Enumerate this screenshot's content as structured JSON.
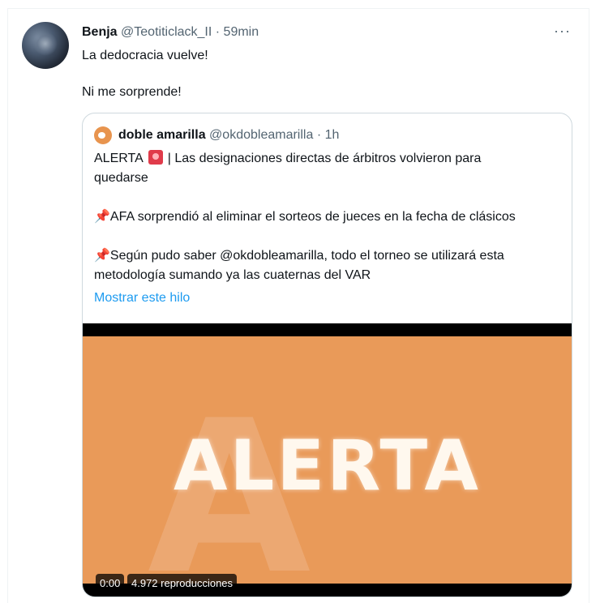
{
  "tweet": {
    "display_name": "Benja",
    "handle": "@Teotiticlack_II",
    "separator": "·",
    "time": "59min",
    "more": "···",
    "line1": "La dedocracia vuelve!",
    "line2": "Ni me sorprende!"
  },
  "quoted": {
    "display_name": "doble amarilla",
    "handle": "@okdobleamarilla",
    "separator": "·",
    "time": "1h",
    "alert_word": "ALERTA",
    "alert_rest": "| Las designaciones directas de árbitros volvieron para",
    "alert_line2": "quedarse",
    "pin1": "AFA sorprendió al eliminar el sorteos de jueces en la fecha de clásicos",
    "pin2_line1": "Según pudo saber @okdobleamarilla, todo el torneo se utilizará esta",
    "pin2_line2": "metodología sumando ya las cuaternas del VAR",
    "show_thread": "Mostrar este hilo"
  },
  "video": {
    "overlay_text": "ALERTA",
    "time": "0:00",
    "views": "4.972 reproducciones"
  },
  "icons": {
    "pin": "pushpin-icon",
    "siren": "rotating-light-icon"
  },
  "colors": {
    "link": "#1d9bf0",
    "video_bg": "#e99a59"
  }
}
